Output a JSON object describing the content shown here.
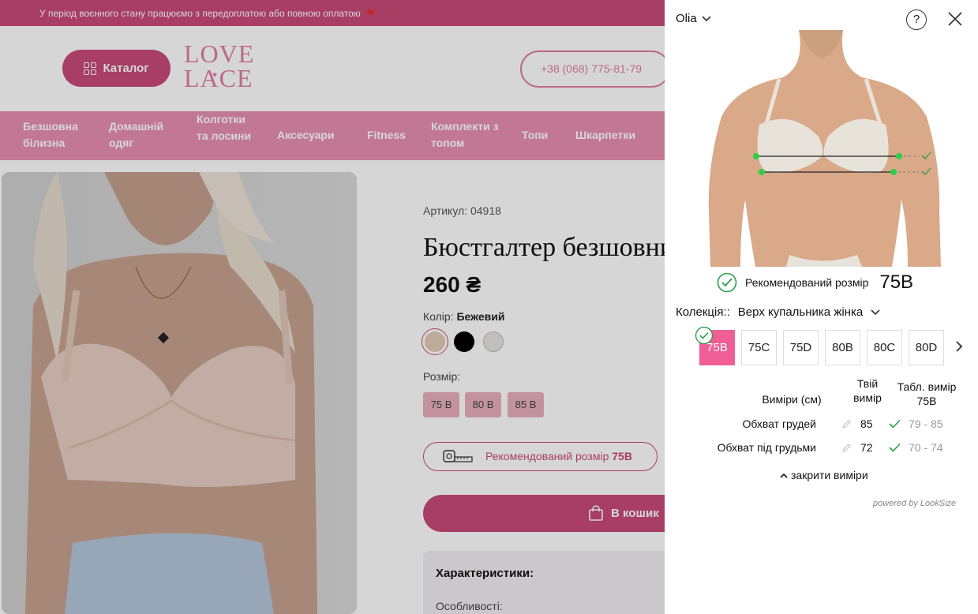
{
  "colors": {
    "brand": "#c94a77",
    "brand_light": "#e88fae",
    "accent_pink": "#ef5f95",
    "check_green": "#2e9e4a"
  },
  "store": {
    "topbar_text": "У період воєнного стану працюємо з передоплатою або повною оплатою",
    "catalog_label": "Каталог",
    "logo_top": "LOVE",
    "logo_bottom": "LACE",
    "phone": "+38 (068) 775-81-79",
    "nav": [
      {
        "label": "Безшовна білизна"
      },
      {
        "label": "Домашній одяг"
      },
      {
        "label": "Колготки та лосини"
      },
      {
        "label": "Аксесуари"
      },
      {
        "label": "Fitness"
      },
      {
        "label": "Комплекти з топом"
      },
      {
        "label": "Топи"
      },
      {
        "label": "Шкарпетки"
      }
    ],
    "product": {
      "sku": "Артикул: 04918",
      "title": "Бюстгалтер безшовний",
      "price": "260 ₴",
      "color_label": "Колір:",
      "color_value": "Бежевий",
      "size_label": "Розмір:",
      "sizes": [
        "75 B",
        "80 B",
        "85 B"
      ],
      "recommend_prefix": "Рекомендований розмір",
      "recommend_size": "75B",
      "cart_label": "В кошик",
      "chars_title": "Характеристики:",
      "chars_sub": "Особливості:"
    }
  },
  "widget": {
    "user": "Olia",
    "help": "?",
    "recommended_label": "Рекомендований розмір",
    "recommended_size": "75B",
    "collection_label": "Колекція::",
    "collection_value": "Верх купальника жінка",
    "sizes": [
      "75B",
      "75C",
      "75D",
      "80B",
      "80C",
      "80D"
    ],
    "selected_size": "75B",
    "headers": {
      "measurements": "Виміри  (см)",
      "your": "Твій вимір",
      "table": "Табл. вимір 75B"
    },
    "rows": [
      {
        "label": "Обхват грудей",
        "value": "85",
        "range": "79 - 85"
      },
      {
        "label": "Обхват під грудьми",
        "value": "72",
        "range": "70 - 74"
      }
    ],
    "close_measurements": "закрити виміри",
    "powered_by": "powered by LookSize"
  }
}
